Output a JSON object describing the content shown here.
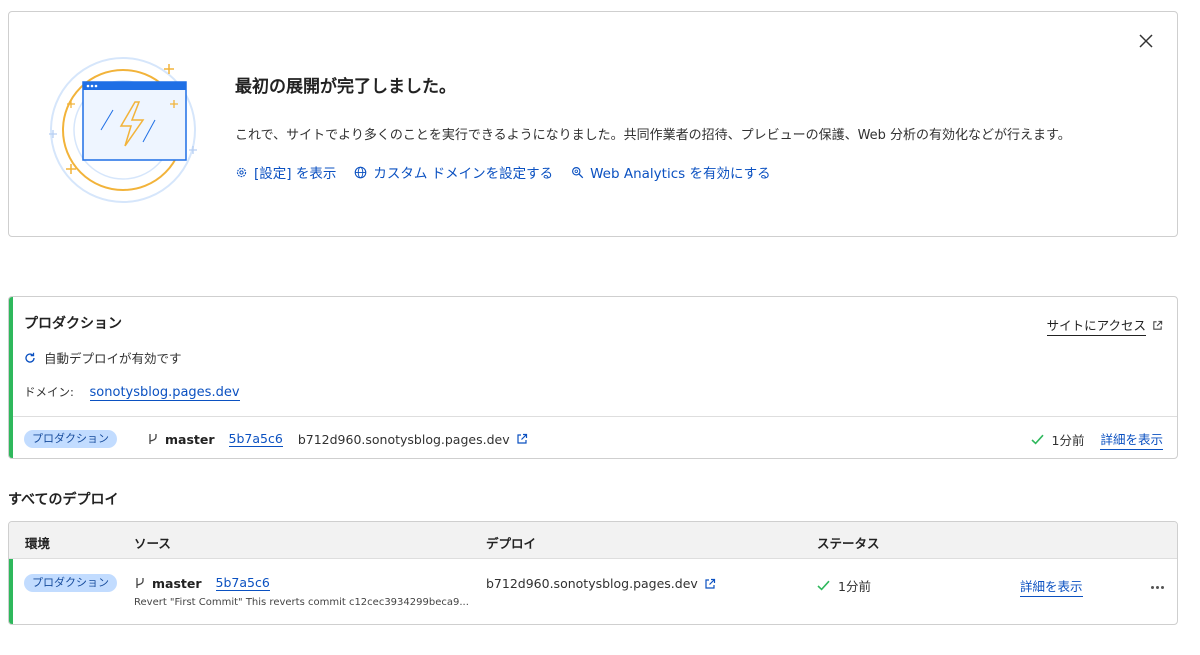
{
  "banner": {
    "title": "最初の展開が完了しました。",
    "description": "これで、サイトでより多くのことを実行できるようになりました。共同作業者の招待、プレビューの保護、Web 分析の有効化などが行えます。",
    "actions": [
      {
        "label": "[設定] を表示",
        "icon": "gear-icon"
      },
      {
        "label": "カスタム ドメインを設定する",
        "icon": "globe-icon"
      },
      {
        "label": "Web Analytics を有効にする",
        "icon": "magnifier-icon"
      }
    ]
  },
  "production": {
    "title": "プロダクション",
    "visit_label": "サイトにアクセス",
    "auto_deploy": "自動デプロイが有効です",
    "domain_label": "ドメイン:",
    "domain_value": "sonotysblog.pages.dev",
    "deploy": {
      "badge": "プロダクション",
      "branch": "master",
      "commit": "5b7a5c6",
      "url": "b712d960.sonotysblog.pages.dev",
      "time": "1分前",
      "details": "詳細を表示"
    }
  },
  "all_deploys": {
    "title": "すべてのデプロイ",
    "columns": [
      "環境",
      "ソース",
      "デプロイ",
      "ステータス"
    ],
    "rows": [
      {
        "badge": "プロダクション",
        "branch": "master",
        "commit": "5b7a5c6",
        "message": "Revert \"First Commit\" This reverts commit c12cec3934299beca9...",
        "url": "b712d960.sonotysblog.pages.dev",
        "time": "1分前",
        "details": "詳細を表示"
      }
    ]
  },
  "colors": {
    "accent_green": "#2eb85c",
    "link_blue": "#0b51c1",
    "badge_bg": "#c2dcff"
  }
}
